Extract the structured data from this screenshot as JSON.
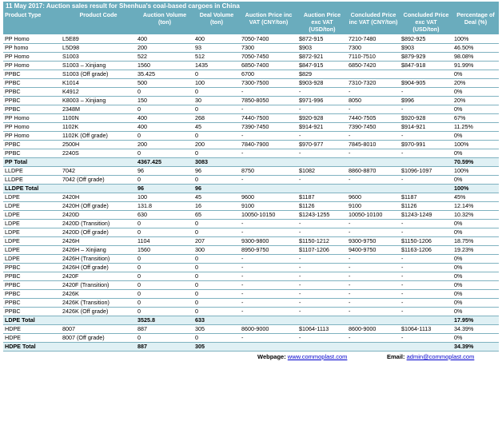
{
  "title": "11 May 2017: Auction sales result for Shenhua's coal-based cargoes in China",
  "columns": [
    "Product Type",
    "Product Code",
    "Auction Volume (ton)",
    "Deal Volume (ton)",
    "Auction Price inc VAT (CNY/ton)",
    "Auction Price exc VAT (USD/ton)",
    "Concluded Price inc VAT (CNY/ton)",
    "Concluded Price exc VAT (USD/ton)",
    "Percentage of Deal (%)"
  ],
  "rows": [
    {
      "total": false,
      "cells": [
        "PP Homo",
        "L5E89",
        "400",
        "400",
        "7050-7400",
        "$872-915",
        "7210-7480",
        "$892-925",
        "100%"
      ]
    },
    {
      "total": false,
      "cells": [
        "PP homo",
        "L5D98",
        "200",
        "93",
        "7300",
        "$903",
        "7300",
        "$903",
        "46.50%"
      ]
    },
    {
      "total": false,
      "cells": [
        "PP Homo",
        "S1003",
        "522",
        "512",
        "7050-7450",
        "$872-921",
        "7110-7510",
        "$879-929",
        "98.08%"
      ]
    },
    {
      "total": false,
      "cells": [
        "PP Homo",
        "S1003 – Xinjiang",
        "1560",
        "1435",
        "6850-7400",
        "$847-915",
        "6850-7420",
        "$847-918",
        "91.99%"
      ]
    },
    {
      "total": false,
      "cells": [
        "PPBC",
        "S1003 (Off grade)",
        "35.425",
        "0",
        "6700",
        "$829",
        "",
        "",
        "0%"
      ]
    },
    {
      "total": false,
      "cells": [
        "PPBC",
        "K1014",
        "500",
        "100",
        "7300-7500",
        "$903-928",
        "7310-7320",
        "$904-905",
        "20%"
      ]
    },
    {
      "total": false,
      "cells": [
        "PPBC",
        "K4912",
        "0",
        "0",
        "-",
        "-",
        "-",
        "-",
        "0%"
      ]
    },
    {
      "total": false,
      "cells": [
        "PPBC",
        "K8003 – Xinjiang",
        "150",
        "30",
        "7850-8050",
        "$971-996",
        "8050",
        "$996",
        "20%"
      ]
    },
    {
      "total": false,
      "cells": [
        "PPBC",
        "2348M",
        "0",
        "0",
        "-",
        "-",
        "-",
        "-",
        "0%"
      ]
    },
    {
      "total": false,
      "cells": [
        "PP Homo",
        "1100N",
        "400",
        "268",
        "7440-7500",
        "$920-928",
        "7440-7505",
        "$920-928",
        "67%"
      ]
    },
    {
      "total": false,
      "cells": [
        "PP Homo",
        "1102K",
        "400",
        "45",
        "7390-7450",
        "$914-921",
        "7390-7450",
        "$914-921",
        "11.25%"
      ]
    },
    {
      "total": false,
      "cells": [
        "PP Homo",
        "1102K (Off grade)",
        "0",
        "0",
        "-",
        "-",
        "-",
        "-",
        "0%"
      ]
    },
    {
      "total": false,
      "cells": [
        "PPBC",
        "2500H",
        "200",
        "200",
        "7840-7900",
        "$970-977",
        "7845-8010",
        "$970-991",
        "100%"
      ]
    },
    {
      "total": false,
      "cells": [
        "PPBC",
        "2240S",
        "0",
        "0",
        "-",
        "-",
        "-",
        "-",
        "0%"
      ]
    },
    {
      "total": true,
      "cells": [
        "PP Total",
        "",
        "4367.425",
        "3083",
        "",
        "",
        "",
        "",
        "70.59%"
      ]
    },
    {
      "total": false,
      "cells": [
        "LLDPE",
        "7042",
        "96",
        "96",
        "8750",
        "$1082",
        "8860-8870",
        "$1096-1097",
        "100%"
      ]
    },
    {
      "total": false,
      "cells": [
        "LLDPE",
        "7042 (Off grade)",
        "0",
        "0",
        "-",
        "-",
        "-",
        "-",
        "0%"
      ]
    },
    {
      "total": true,
      "cells": [
        "LLDPE Total",
        "",
        "96",
        "96",
        "",
        "",
        "",
        "",
        "100%"
      ]
    },
    {
      "total": false,
      "cells": [
        "LDPE",
        "2420H",
        "100",
        "45",
        "9600",
        "$1187",
        "9600",
        "$1187",
        "45%"
      ]
    },
    {
      "total": false,
      "cells": [
        "LDPE",
        "2420H (Off grade)",
        "131.8",
        "16",
        "9100",
        "$1126",
        "9100",
        "$1126",
        "12.14%"
      ]
    },
    {
      "total": false,
      "cells": [
        "LDPE",
        "2420D",
        "630",
        "65",
        "10050-10150",
        "$1243-1255",
        "10050-10100",
        "$1243-1249",
        "10.32%"
      ]
    },
    {
      "total": false,
      "cells": [
        "LDPE",
        "2420D (Transition)",
        "0",
        "0",
        "-",
        "-",
        "-",
        "-",
        "0%"
      ]
    },
    {
      "total": false,
      "cells": [
        "LDPE",
        "2420D (Off grade)",
        "0",
        "0",
        "-",
        "-",
        "-",
        "-",
        "0%"
      ]
    },
    {
      "total": false,
      "cells": [
        "LDPE",
        "2426H",
        "1104",
        "207",
        "9300-9800",
        "$1150-1212",
        "9300-9750",
        "$1150-1206",
        "18.75%"
      ]
    },
    {
      "total": false,
      "cells": [
        "LDPE",
        "2426H – Xinjiang",
        "1560",
        "300",
        "8950-9750",
        "$1107-1206",
        "9400-9750",
        "$1163-1206",
        "19.23%"
      ]
    },
    {
      "total": false,
      "cells": [
        "LDPE",
        "2426H (Transition)",
        "0",
        "0",
        "-",
        "-",
        "-",
        "-",
        "0%"
      ]
    },
    {
      "total": false,
      "cells": [
        "PPBC",
        "2426H (Off grade)",
        "0",
        "0",
        "-",
        "-",
        "-",
        "-",
        "0%"
      ]
    },
    {
      "total": false,
      "cells": [
        "PPBC",
        "2420F",
        "0",
        "0",
        "-",
        "-",
        "-",
        "-",
        "0%"
      ]
    },
    {
      "total": false,
      "cells": [
        "PPBC",
        "2420F (Transition)",
        "0",
        "0",
        "-",
        "-",
        "-",
        "-",
        "0%"
      ]
    },
    {
      "total": false,
      "cells": [
        "PPBC",
        "2426K",
        "0",
        "0",
        "-",
        "-",
        "-",
        "-",
        "0%"
      ]
    },
    {
      "total": false,
      "cells": [
        "PPBC",
        "2426K (Transition)",
        "0",
        "0",
        "-",
        "-",
        "-",
        "-",
        "0%"
      ]
    },
    {
      "total": false,
      "cells": [
        "PPBC",
        "2426K (Off grade)",
        "0",
        "0",
        "-",
        "-",
        "-",
        "-",
        "0%"
      ]
    },
    {
      "total": true,
      "cells": [
        "LDPE Total",
        "",
        "3525.8",
        "633",
        "",
        "",
        "",
        "",
        "17.95%"
      ]
    },
    {
      "total": false,
      "cells": [
        "HDPE",
        "8007",
        "887",
        "305",
        "8600-9000",
        "$1064-1113",
        "8600-9000",
        "$1064-1113",
        "34.39%"
      ]
    },
    {
      "total": false,
      "cells": [
        "HDPE",
        "8007 (Off grade)",
        "0",
        "0",
        "-",
        "-",
        "-",
        "-",
        "0%"
      ]
    },
    {
      "total": true,
      "cells": [
        "HDPE Total",
        "",
        "887",
        "305",
        "",
        "",
        "",
        "",
        "34.39%"
      ]
    }
  ],
  "footer": {
    "webpage_label": "Webpage:",
    "webpage_link": "www.commoplast.com",
    "email_label": "Email:",
    "email_link": "admin@commoplast.com"
  },
  "colors": {
    "header_bg": "#6aacbd",
    "total_row_bg": "#dff0f4",
    "rule": "#7fb2c0",
    "link": "#0000cc"
  }
}
